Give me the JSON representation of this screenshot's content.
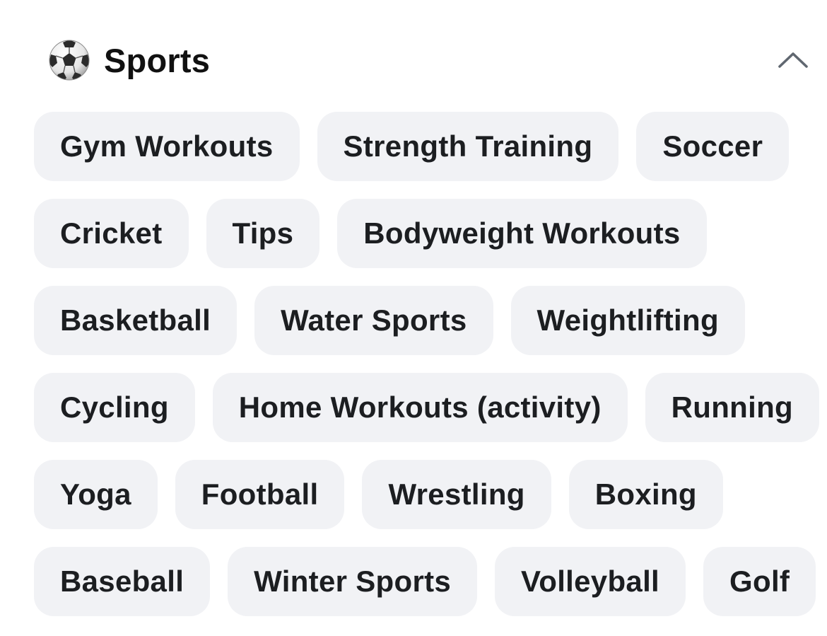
{
  "section": {
    "title": "Sports",
    "icon": "soccer-ball-icon",
    "collapse_icon": "chevron-up-icon"
  },
  "topics": [
    [
      "Gym Workouts",
      "Strength Training",
      "Soccer"
    ],
    [
      "Cricket",
      "Tips",
      "Bodyweight Workouts"
    ],
    [
      "Basketball",
      "Water Sports",
      "Weightlifting"
    ],
    [
      "Cycling",
      "Home Workouts (activity)",
      "Running"
    ],
    [
      "Yoga",
      "Football",
      "Wrestling",
      "Boxing"
    ],
    [
      "Baseball",
      "Winter Sports",
      "Volleyball",
      "Golf"
    ]
  ],
  "colors": {
    "chip_background": "#f1f2f5",
    "text": "#1c1e21",
    "chevron": "#606770"
  }
}
